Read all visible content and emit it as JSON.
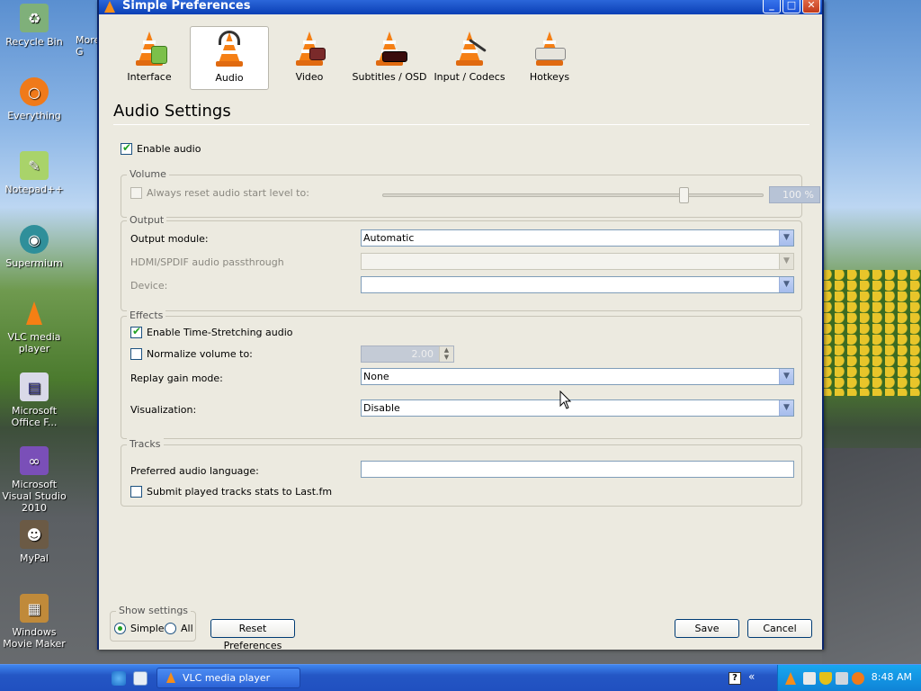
{
  "desktop": {
    "icons": [
      {
        "label": "Recycle Bin"
      },
      {
        "label": "Everything"
      },
      {
        "label": "Notepad++"
      },
      {
        "label": "Supermium"
      },
      {
        "label": "VLC media player"
      },
      {
        "label": "Microsoft Office F..."
      },
      {
        "label": "Microsoft Visual Studio 2010"
      },
      {
        "label": "MyPal"
      },
      {
        "label": "Windows Movie Maker"
      }
    ],
    "partial_label": "More G"
  },
  "window": {
    "title": "Simple Preferences",
    "buttons": {
      "minimize": "_",
      "maximize": "□",
      "close": "✕"
    }
  },
  "categories": [
    {
      "label": "Interface",
      "icon": "interface-icon",
      "active": false
    },
    {
      "label": "Audio",
      "icon": "audio-headphones-icon",
      "active": true
    },
    {
      "label": "Video",
      "icon": "video-icon",
      "active": false
    },
    {
      "label": "Subtitles / OSD",
      "icon": "subtitles-icon",
      "active": false
    },
    {
      "label": "Input / Codecs",
      "icon": "input-codecs-icon",
      "active": false
    },
    {
      "label": "Hotkeys",
      "icon": "hotkeys-icon",
      "active": false
    }
  ],
  "audio": {
    "section_title": "Audio Settings",
    "enable_audio": {
      "label": "Enable audio",
      "checked": true
    },
    "volume": {
      "group_label": "Volume",
      "reset_label": "Always reset audio start level to:",
      "reset_checked": false,
      "level_value": "100 %",
      "level_fraction": 0.79
    },
    "output": {
      "group_label": "Output",
      "module_label": "Output module:",
      "module_value": "Automatic",
      "passthrough_label": "HDMI/SPDIF audio passthrough",
      "passthrough_value": "",
      "device_label": "Device:",
      "device_value": ""
    },
    "effects": {
      "group_label": "Effects",
      "timestretch_label": "Enable Time-Stretching audio",
      "timestretch_checked": true,
      "normalize_label": "Normalize volume to:",
      "normalize_checked": false,
      "normalize_value": "2.00",
      "replay_gain_label": "Replay gain mode:",
      "replay_gain_value": "None",
      "visualization_label": "Visualization:",
      "visualization_value": "Disable"
    },
    "tracks": {
      "group_label": "Tracks",
      "language_label": "Preferred audio language:",
      "language_value": "",
      "lastfm_label": "Submit played tracks stats to Last.fm",
      "lastfm_checked": false
    }
  },
  "footer": {
    "show_settings_label": "Show settings",
    "simple_label": "Simple",
    "all_label": "All",
    "selected_mode": "Simple",
    "reset_label": "Reset Preferences",
    "save_label": "Save",
    "cancel_label": "Cancel"
  },
  "taskbar": {
    "task_label": "VLC media player",
    "clock": "8:48 AM",
    "help_glyph": "?",
    "chevron_glyph": "«"
  },
  "colors": {
    "titlebar": "#0a3fb5",
    "dialog_bg": "#eceae0",
    "check_tick": "#21a121",
    "vlc_orange": "#f57f14",
    "taskbar": "#2456c4",
    "tray": "#0f82d6"
  }
}
